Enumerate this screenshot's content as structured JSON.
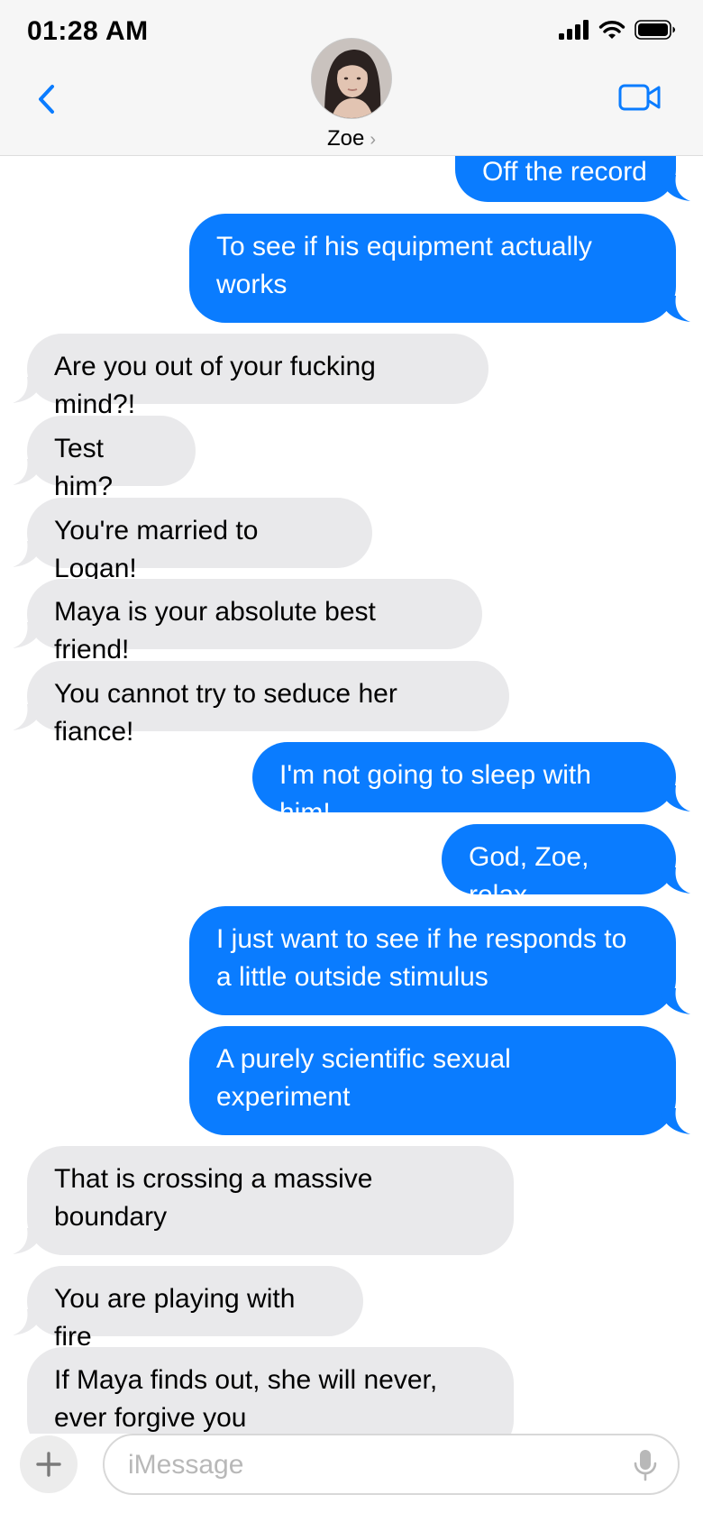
{
  "status_bar": {
    "time": "01:28 AM",
    "icons": [
      "cellular-signal-icon",
      "wifi-icon",
      "battery-icon"
    ]
  },
  "header": {
    "contact_name": "Zoe",
    "chevron": "›",
    "back_icon": "chevron-left-icon",
    "video_icon": "video-camera-icon"
  },
  "messages": [
    {
      "from": "me",
      "text": "Off the record"
    },
    {
      "from": "me",
      "text": "To see if his equipment actually works"
    },
    {
      "from": "them",
      "text": "Are you out of your fucking mind?!"
    },
    {
      "from": "them",
      "text": "Test him?"
    },
    {
      "from": "them",
      "text": "You're married to Logan!"
    },
    {
      "from": "them",
      "text": "Maya is your absolute best friend!"
    },
    {
      "from": "them",
      "text": "You cannot try to seduce her fiance!"
    },
    {
      "from": "me",
      "text": "I'm not going to sleep with him!"
    },
    {
      "from": "me",
      "text": "God, Zoe, relax"
    },
    {
      "from": "me",
      "text": "I just want to see if he responds to a little outside stimulus"
    },
    {
      "from": "me",
      "text": "A purely scientific sexual experiment"
    },
    {
      "from": "them",
      "text": "That is crossing a massive boundary"
    },
    {
      "from": "them",
      "text": "You are playing with fire"
    },
    {
      "from": "them",
      "text": "If Maya finds out, she will never, ever forgive you"
    }
  ],
  "composer": {
    "placeholder": "iMessage",
    "plus_icon": "plus-icon",
    "mic_icon": "microphone-icon"
  },
  "colors": {
    "outgoing_bubble": "#0a7cff",
    "incoming_bubble": "#e9e9eb",
    "accent": "#0a7cff",
    "header_background": "#f6f6f6"
  }
}
